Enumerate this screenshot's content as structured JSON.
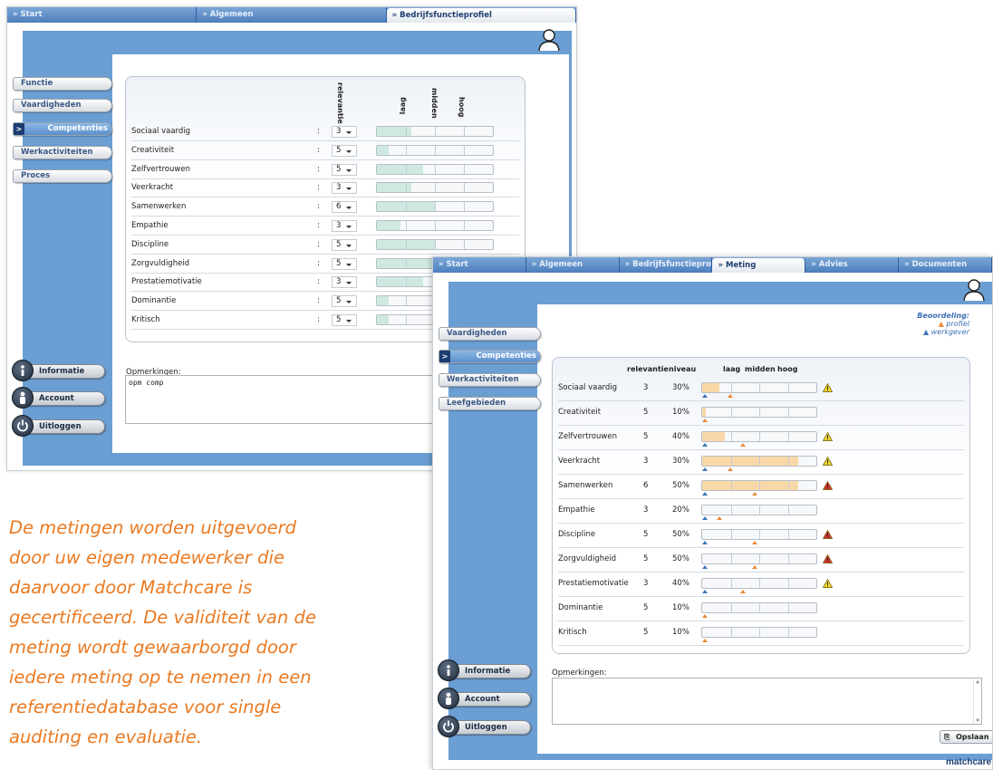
{
  "w1": {
    "tabs": [
      "Start",
      "Algemeen",
      "Bedrijfsfunctieprofiel"
    ],
    "active_tab": 2,
    "sidebar": [
      "Functie",
      "Vaardigheden",
      "Competenties",
      "Werkactiviteiten",
      "Proces"
    ],
    "active_side": 2,
    "headers": {
      "relevantie": "relevantie",
      "laag": "laag",
      "midden": "midden",
      "hoog": "hoog"
    },
    "rows": [
      {
        "label": "Sociaal vaardig",
        "rel": "3",
        "level": 0.3
      },
      {
        "label": "Creativiteit",
        "rel": "5",
        "level": 0.1
      },
      {
        "label": "Zelfvertrouwen",
        "rel": "5",
        "level": 0.4
      },
      {
        "label": "Veerkracht",
        "rel": "3",
        "level": 0.3
      },
      {
        "label": "Samenwerken",
        "rel": "6",
        "level": 0.5
      },
      {
        "label": "Empathie",
        "rel": "3",
        "level": 0.2
      },
      {
        "label": "Discipline",
        "rel": "5",
        "level": 0.5
      },
      {
        "label": "Zorgvuldigheid",
        "rel": "5",
        "level": 0.5
      },
      {
        "label": "Prestatiemotivatie",
        "rel": "3",
        "level": 0.4
      },
      {
        "label": "Dominantie",
        "rel": "5",
        "level": 0.1
      },
      {
        "label": "Kritisch",
        "rel": "5",
        "level": 0.1
      }
    ],
    "colon": ":",
    "remarks_label": "Opmerkingen:",
    "remarks_text": "opm comp",
    "buttons": [
      "Informatie",
      "Account",
      "Uitloggen"
    ]
  },
  "w2": {
    "tabs": [
      "Start",
      "Algemeen",
      "Bedrijfsfunctieprofiel",
      "Meting",
      "Advies",
      "Documenten"
    ],
    "active_tab": 3,
    "sidebar": [
      "Vaardigheden",
      "Competenties",
      "Werkactiviteiten",
      "Leefgebieden"
    ],
    "active_side": 1,
    "legend_title": "Beoordeling:",
    "legend_profiel": "profiel",
    "legend_werkgever": "werkgever",
    "headers": {
      "relevantie": "relevantie",
      "niveau": "niveau",
      "laag": "laag",
      "midden": "midden",
      "hoog": "hoog"
    },
    "rows": [
      {
        "label": "Sociaal vaardig",
        "rel": "3",
        "niveau": "30%",
        "fill": 0.15,
        "prof": 0.25,
        "emp": 0.03,
        "warn": "yellow"
      },
      {
        "label": "Creativiteit",
        "rel": "5",
        "niveau": "10%",
        "fill": 0.03,
        "prof": 0.03,
        "emp": null,
        "warn": null
      },
      {
        "label": "Zelfvertrouwen",
        "rel": "5",
        "niveau": "40%",
        "fill": 0.2,
        "prof": 0.36,
        "emp": 0.03,
        "warn": "yellow"
      },
      {
        "label": "Veerkracht",
        "rel": "3",
        "niveau": "30%",
        "fill": 0.84,
        "prof": 0.25,
        "emp": 0.03,
        "warn": "yellow"
      },
      {
        "label": "Samenwerken",
        "rel": "6",
        "niveau": "50%",
        "fill": 0.84,
        "prof": 0.46,
        "emp": 0.03,
        "warn": "red"
      },
      {
        "label": "Empathie",
        "rel": "3",
        "niveau": "20%",
        "fill": 0.0,
        "prof": 0.16,
        "emp": 0.03,
        "warn": null
      },
      {
        "label": "Discipline",
        "rel": "5",
        "niveau": "50%",
        "fill": 0.0,
        "prof": 0.46,
        "emp": 0.03,
        "warn": "red"
      },
      {
        "label": "Zorgvuldigheid",
        "rel": "5",
        "niveau": "50%",
        "fill": 0.0,
        "prof": 0.46,
        "emp": 0.03,
        "warn": "red"
      },
      {
        "label": "Prestatiemotivatie",
        "rel": "3",
        "niveau": "40%",
        "fill": 0.0,
        "prof": 0.36,
        "emp": 0.03,
        "warn": "yellow"
      },
      {
        "label": "Dominantie",
        "rel": "5",
        "niveau": "10%",
        "fill": 0.0,
        "prof": 0.03,
        "emp": null,
        "warn": null
      },
      {
        "label": "Kritisch",
        "rel": "5",
        "niveau": "10%",
        "fill": 0.0,
        "prof": 0.03,
        "emp": null,
        "warn": null
      }
    ],
    "remarks_label": "Opmerkingen:",
    "save_label": "Opslaan",
    "buttons": [
      "Informatie",
      "Account",
      "Uitloggen"
    ],
    "brand": "matchcare"
  },
  "colors": {
    "green_fill": "#cfe9e1",
    "orange_fill": "#f9d8a8",
    "accent_blue": "#6b9ed2",
    "caption": "#ea7a22"
  },
  "caption": "De metingen worden uitgevoerd door uw eigen medewerker die daarvoor door Matchcare is gecertificeerd. De validiteit van de meting wordt gewaarborgd door iedere meting op te nemen in een referentiedatabase voor single auditing en evaluatie."
}
